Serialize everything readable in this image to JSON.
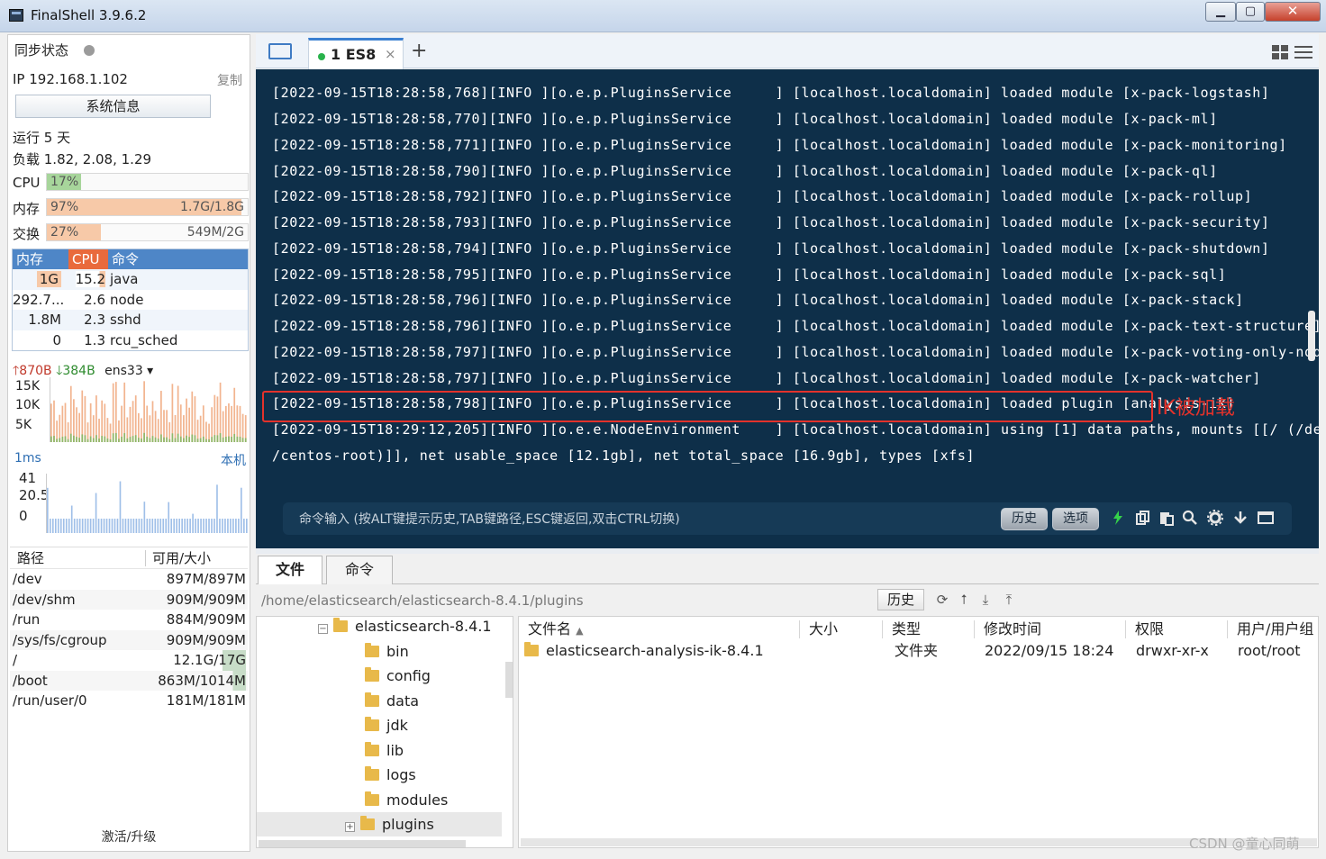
{
  "window": {
    "title": "FinalShell 3.9.6.2",
    "min": "▁",
    "max": "▢",
    "close": "✕"
  },
  "left": {
    "sync_label": "同步状态",
    "ip_label": "IP 192.168.1.102",
    "copy_label": "复制",
    "sysinfo_button": "系统信息",
    "uptime": "运行 5 天",
    "load": "负载 1.82, 2.08, 1.29",
    "cpu": {
      "label": "CPU",
      "percent": "17%",
      "fraction": 0.17,
      "amount": "",
      "color": "#a7d59b"
    },
    "mem": {
      "label": "内存",
      "percent": "97%",
      "fraction": 0.97,
      "amount": "1.7G/1.8G",
      "color": "#f7c9a8"
    },
    "swap": {
      "label": "交换",
      "percent": "27%",
      "fraction": 0.27,
      "amount": "549M/2G",
      "color": "#f7c9a8"
    },
    "proc_headers": [
      "内存",
      "CPU",
      "命令"
    ],
    "processes": [
      {
        "mem": "1G",
        "cpu": "15.2",
        "cmd": "java"
      },
      {
        "mem": "292.7...",
        "cpu": "2.6",
        "cmd": "node"
      },
      {
        "mem": "1.8M",
        "cpu": "2.3",
        "cmd": "sshd"
      },
      {
        "mem": "0",
        "cpu": "1.3",
        "cmd": "rcu_sched"
      }
    ],
    "net": {
      "up": "870B",
      "down": "384B",
      "iface": "ens33",
      "ticks": [
        "15K",
        "10K",
        "5K"
      ]
    },
    "latency": {
      "value": "1ms",
      "host": "本机",
      "ticks": [
        "41",
        "20.5",
        "0"
      ]
    },
    "disk_headers": [
      "路径",
      "可用/大小"
    ],
    "disks": [
      {
        "path": "/dev",
        "size": "897M/897M"
      },
      {
        "path": "/dev/shm",
        "size": "909M/909M"
      },
      {
        "path": "/run",
        "size": "884M/909M"
      },
      {
        "path": "/sys/fs/cgroup",
        "size": "909M/909M"
      },
      {
        "path": "/",
        "size": "12.1G/17G"
      },
      {
        "path": "/boot",
        "size": "863M/1014M"
      },
      {
        "path": "/run/user/0",
        "size": "181M/181M"
      }
    ],
    "activate": "激活/升级"
  },
  "tabs": {
    "session": "1 ES8",
    "close": "×",
    "add": "+"
  },
  "terminal": {
    "lines": [
      "[2022-09-15T18:28:58,768][INFO ][o.e.p.PluginsService     ] [localhost.localdomain] loaded module [x-pack-logstash]",
      "[2022-09-15T18:28:58,770][INFO ][o.e.p.PluginsService     ] [localhost.localdomain] loaded module [x-pack-ml]",
      "[2022-09-15T18:28:58,771][INFO ][o.e.p.PluginsService     ] [localhost.localdomain] loaded module [x-pack-monitoring]",
      "[2022-09-15T18:28:58,790][INFO ][o.e.p.PluginsService     ] [localhost.localdomain] loaded module [x-pack-ql]",
      "[2022-09-15T18:28:58,792][INFO ][o.e.p.PluginsService     ] [localhost.localdomain] loaded module [x-pack-rollup]",
      "[2022-09-15T18:28:58,793][INFO ][o.e.p.PluginsService     ] [localhost.localdomain] loaded module [x-pack-security]",
      "[2022-09-15T18:28:58,794][INFO ][o.e.p.PluginsService     ] [localhost.localdomain] loaded module [x-pack-shutdown]",
      "[2022-09-15T18:28:58,795][INFO ][o.e.p.PluginsService     ] [localhost.localdomain] loaded module [x-pack-sql]",
      "[2022-09-15T18:28:58,796][INFO ][o.e.p.PluginsService     ] [localhost.localdomain] loaded module [x-pack-stack]",
      "[2022-09-15T18:28:58,796][INFO ][o.e.p.PluginsService     ] [localhost.localdomain] loaded module [x-pack-text-structure]",
      "[2022-09-15T18:28:58,797][INFO ][o.e.p.PluginsService     ] [localhost.localdomain] loaded module [x-pack-voting-only-node]",
      "[2022-09-15T18:28:58,797][INFO ][o.e.p.PluginsService     ] [localhost.localdomain] loaded module [x-pack-watcher]",
      "[2022-09-15T18:28:58,798][INFO ][o.e.p.PluginsService     ] [localhost.localdomain] loaded plugin [analysis-ik]",
      "[2022-09-15T18:29:12,205][INFO ][o.e.e.NodeEnvironment    ] [localhost.localdomain] using [1] data paths, mounts [[/ (/dev/mapper",
      "/centos-root)]], net usable_space [12.1gb], net total_space [16.9gb], types [xfs]"
    ],
    "annotation": "IK被加载",
    "command_placeholder": "命令输入 (按ALT键提示历史,TAB键路径,ESC键返回,双击CTRL切换)",
    "history_button": "历史",
    "options_button": "选项"
  },
  "bottom": {
    "tabs": [
      "文件",
      "命令"
    ],
    "path": "/home/elasticsearch/elasticsearch-8.4.1/plugins",
    "history_button": "历史",
    "tree_root": "elasticsearch-8.4.1",
    "tree_items": [
      "bin",
      "config",
      "data",
      "jdk",
      "lib",
      "logs",
      "modules",
      "plugins"
    ],
    "file_headers": [
      "文件名",
      "大小",
      "类型",
      "修改时间",
      "权限",
      "用户/用户组"
    ],
    "files": [
      {
        "name": "elasticsearch-analysis-ik-8.4.1",
        "size": "",
        "type": "文件夹",
        "mtime": "2022/09/15 18:24",
        "perm": "drwxr-xr-x",
        "owner": "root/root"
      }
    ]
  },
  "watermark": "CSDN @童心同萌"
}
